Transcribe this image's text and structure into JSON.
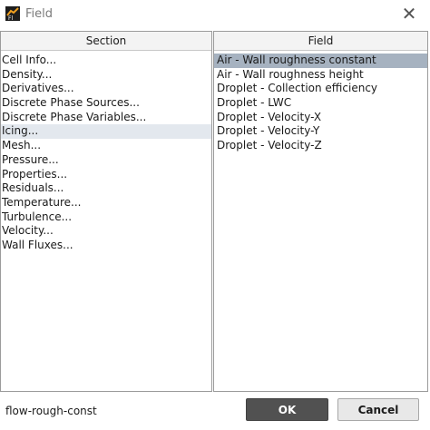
{
  "window": {
    "title": "Field",
    "icon": "fluent-app-icon",
    "close_icon": "close-icon"
  },
  "section_panel": {
    "header": "Section",
    "items": [
      "Cell Info...",
      "Density...",
      "Derivatives...",
      "Discrete Phase Sources...",
      "Discrete Phase Variables...",
      "Icing...",
      "Mesh...",
      "Pressure...",
      "Properties...",
      "Residuals...",
      "Temperature...",
      "Turbulence...",
      "Velocity...",
      "Wall Fluxes..."
    ],
    "selected_index": 5
  },
  "field_panel": {
    "header": "Field",
    "items": [
      "Air - Wall roughness constant",
      "Air - Wall roughness height",
      "Droplet - Collection efficiency",
      "Droplet - LWC",
      "Droplet - Velocity-X",
      "Droplet - Velocity-Y",
      "Droplet - Velocity-Z"
    ],
    "selected_index": 0
  },
  "footer": {
    "status": "flow-rough-const",
    "ok_label": "OK",
    "cancel_label": "Cancel"
  }
}
